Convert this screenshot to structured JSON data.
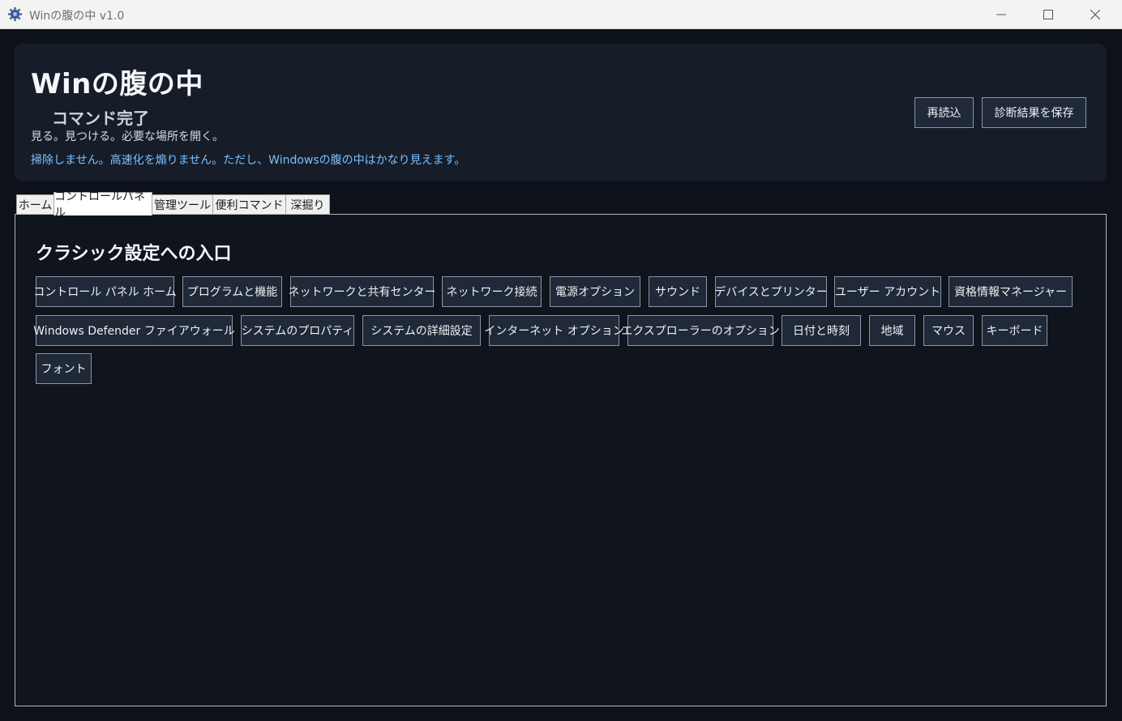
{
  "window": {
    "title": "Winの腹の中 v1.0",
    "icon": "gear-bug-icon"
  },
  "header": {
    "title": "Winの腹の中",
    "status": "コマンド完了",
    "tagline": "見る。見つける。必要な場所を開く。",
    "note": "掃除しません。高速化を煽りません。ただし、Windowsの腹の中はかなり見えます。",
    "reload_label": "再読込",
    "save_label": "診断結果を保存"
  },
  "tabs": [
    "ホーム",
    "コントロールパネル",
    "管理ツール",
    "便利コマンド",
    "深掘り"
  ],
  "active_tab": "コントロールパネル",
  "panel": {
    "title": "クラシック設定への入口",
    "buttons": [
      "コントロール パネル ホーム",
      "プログラムと機能",
      "ネットワークと共有センター",
      "ネットワーク接続",
      "電源オプション",
      "サウンド",
      "デバイスとプリンター",
      "ユーザー アカウント",
      "資格情報マネージャー",
      "Windows Defender ファイアウォール",
      "システムのプロパティ",
      "システムの詳細設定",
      "インターネット オプション",
      "エクスプローラーのオプション",
      "日付と時刻",
      "地域",
      "マウス",
      "キーボード",
      "フォント"
    ]
  },
  "colors": {
    "background": "#0d1119",
    "card": "#161d29",
    "button": "#1f2937",
    "accent_text": "#7cc0ff"
  }
}
